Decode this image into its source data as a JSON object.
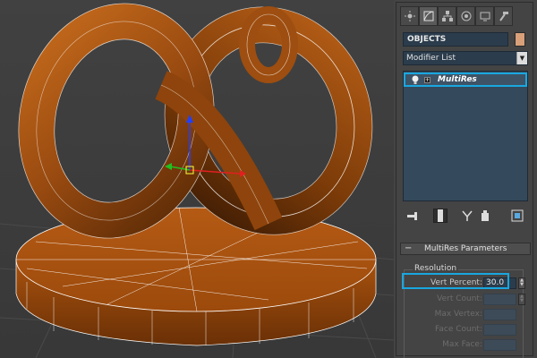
{
  "panel": {
    "tabs": [
      {
        "icon": "sun-icon",
        "active": false
      },
      {
        "icon": "curve-edit-icon",
        "active": true
      },
      {
        "icon": "hierarchy-icon",
        "active": false
      },
      {
        "icon": "motion-icon",
        "active": false
      },
      {
        "icon": "display-icon",
        "active": false
      },
      {
        "icon": "hammer-icon",
        "active": false
      }
    ],
    "object_name": "OBJECTS",
    "object_color": "#d9a079",
    "modifier_list": "Modifier List",
    "stack_item": "MultiRes",
    "stack_tools": [
      "pin-stack-icon",
      "show-end-result-icon",
      "make-unique-icon",
      "remove-modifier-icon",
      "configure-sets-icon"
    ],
    "rollout_title": "MultiRes Parameters",
    "group_label": "Resolution",
    "fields": [
      {
        "label": "Vert Percent:",
        "value": "30.0",
        "enabled": true
      },
      {
        "label": "Vert Count:",
        "value": "",
        "enabled": false
      },
      {
        "label": "Max Vertex:",
        "value": "",
        "enabled": false
      },
      {
        "label": "Face Count:",
        "value": "",
        "enabled": false
      },
      {
        "label": "Max Face:",
        "value": "",
        "enabled": false
      }
    ]
  },
  "colors": {
    "accent_highlight": "#19a7e0",
    "mesh_orange": "#a9520f",
    "wire": "#ffffff"
  }
}
